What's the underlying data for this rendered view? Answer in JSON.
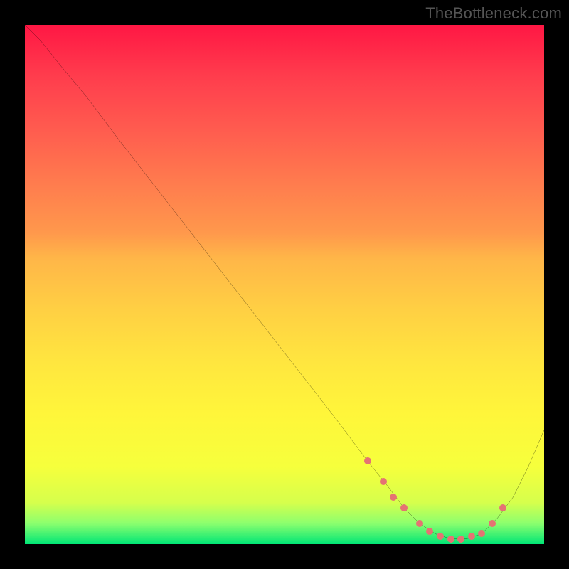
{
  "attribution": "TheBottleneck.com",
  "chart_data": {
    "type": "line",
    "title": "",
    "xlabel": "",
    "ylabel": "",
    "xlim": [
      0,
      100
    ],
    "ylim": [
      0,
      100
    ],
    "series": [
      {
        "name": "curve",
        "x": [
          0,
          3,
          7,
          12,
          18,
          25,
          32,
          39,
          46,
          53,
          60,
          66,
          70,
          73,
          76,
          79,
          82,
          85,
          88,
          91,
          94,
          97,
          100
        ],
        "y": [
          100,
          97,
          92,
          86,
          78,
          69,
          60,
          51,
          42,
          33,
          24,
          16,
          11,
          7,
          4,
          2,
          1,
          1,
          2,
          5,
          9,
          15,
          22
        ]
      }
    ],
    "dots": {
      "name": "markers",
      "x": [
        66,
        69,
        71,
        73,
        76,
        78,
        80,
        82,
        84,
        86,
        88,
        90,
        92
      ],
      "y": [
        16,
        12,
        9,
        7,
        4,
        2.5,
        1.5,
        1,
        1,
        1.5,
        2,
        4,
        7
      ]
    },
    "background_gradient": {
      "orientation": "vertical",
      "stops": [
        {
          "pos": 0.0,
          "color": "#ff1744"
        },
        {
          "pos": 0.5,
          "color": "#ffd043"
        },
        {
          "pos": 0.9,
          "color": "#f6ff3c"
        },
        {
          "pos": 1.0,
          "color": "#00e676"
        }
      ]
    }
  }
}
